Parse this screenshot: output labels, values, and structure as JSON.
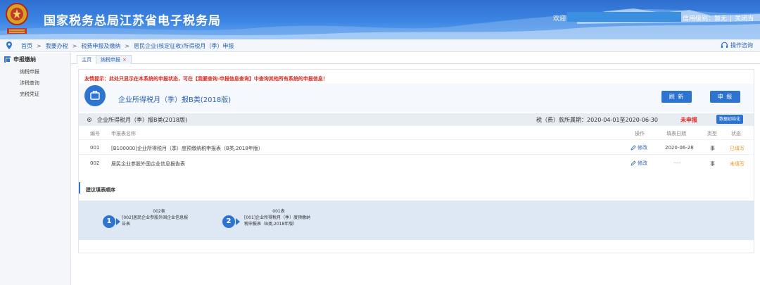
{
  "header": {
    "site_title": "国家税务总局江苏省电子税务局",
    "welcome": "欢迎",
    "credit_level": "信用级别：暂无",
    "separator": "|",
    "close_all": "关闭当",
    "colors": {
      "header_blue": "#3d86e4",
      "accent_blue": "#2d74d1",
      "alert_red": "#e0261f",
      "pending_orange": "#f29a1f"
    }
  },
  "breadcrumb": {
    "items": [
      "首页",
      "我要办税",
      "税费申报及缴纳",
      "居民企业(核定征收)所得税月（季）申报"
    ],
    "separator": ">",
    "help": "操作咨询"
  },
  "sidebar": {
    "title": "申报缴纳",
    "items": [
      "纳税申报",
      "涉税查询",
      "完税凭证"
    ]
  },
  "tabs": [
    {
      "label": "主页"
    },
    {
      "label": "纳税申报",
      "close": "×"
    }
  ],
  "notice": "友情提示：此处只显示在本系统的申报状态，可在【我要查询-申报信息查询】中查询其他所有系统的申报信息！",
  "form": {
    "title": "企业所得税月（季）报B类(2018版)",
    "refresh_button": "刷 新",
    "submit_button": "申 报"
  },
  "section": {
    "name": "企业所得税月（季）报B类(2018版)",
    "period": "税（费）款所属期：2020-04-01至2020-06-30",
    "status": "未申报",
    "init_button": "数据初始化"
  },
  "table": {
    "headers": [
      "编号",
      "申报表名称",
      "操作",
      "填表日期",
      "类型",
      "状态"
    ],
    "rows": [
      {
        "no": "001",
        "name": "[B100000]企业所得税月（季）度预缴纳税申报表（B类,2018年版）",
        "action": "修改",
        "date": "2020-06-28",
        "type": "事",
        "status": "已填写"
      },
      {
        "no": "002",
        "name": "居民企业参股外国企业信息报告表",
        "action": "修改",
        "date": "----",
        "type": "事",
        "status": "未填写"
      }
    ]
  },
  "order": {
    "title": "建议填表顺序",
    "steps": [
      {
        "num": "1",
        "code": "002表",
        "line1": "[002]居民企业参股外国企业信息报",
        "line2": "告表"
      },
      {
        "num": "2",
        "code": "001表",
        "line1": "[001]企业所得税月（季）度预缴纳",
        "line2": "税申报表（B类,2018年版）"
      }
    ]
  }
}
